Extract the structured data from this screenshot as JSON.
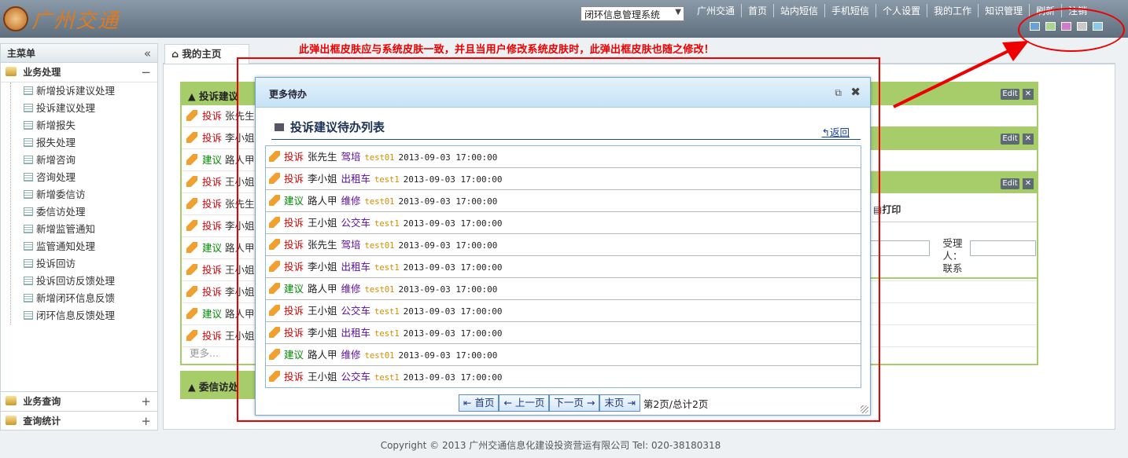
{
  "app": {
    "logo_text": "广州交通",
    "system_select": "闭环信息管理系统",
    "top_nav": [
      "广州交通",
      "首页",
      "站内短信",
      "手机短信",
      "个人设置",
      "我的工作",
      "知识管理",
      "刷新",
      "注销"
    ],
    "skin_colors": [
      "#6aa0d8",
      "#a8d690",
      "#d27ad0",
      "#c8c8c8",
      "#8cc8e8"
    ]
  },
  "sidebar": {
    "title": "主菜单",
    "collapse_glyph": "«",
    "group1": {
      "label": "业务处理",
      "toggle": "−",
      "items": [
        "新增投诉建议处理",
        "投诉建议处理",
        "新增报失",
        "报失处理",
        "新增咨询",
        "咨询处理",
        "新增委信访",
        "委信访处理",
        "新增监管通知",
        "监管通知处理",
        "投诉回访",
        "投诉回访反馈处理",
        "新增闭环信息反馈",
        "闭环信息反馈处理"
      ]
    },
    "group2": {
      "label": "业务查询",
      "toggle": "+"
    },
    "group3": {
      "label": "查询统计",
      "toggle": "+"
    }
  },
  "tabs": {
    "home": "我的主页"
  },
  "panels": {
    "panel1_title": "投诉建议",
    "panel4_title": "委信访处",
    "edit_label": "Edit",
    "close_label": "✕",
    "more_label": "更多...",
    "rows": [
      {
        "kind": "投诉",
        "name": "张先生",
        "color": "red"
      },
      {
        "kind": "投诉",
        "name": "李小姐",
        "color": "red"
      },
      {
        "kind": "建议",
        "name": "路人甲",
        "color": "green"
      },
      {
        "kind": "投诉",
        "name": "王小姐",
        "color": "red"
      },
      {
        "kind": "投诉",
        "name": "张先生",
        "color": "red"
      },
      {
        "kind": "投诉",
        "name": "李小姐",
        "color": "red"
      },
      {
        "kind": "建议",
        "name": "路人甲",
        "color": "green"
      },
      {
        "kind": "投诉",
        "name": "王小姐",
        "color": "red"
      },
      {
        "kind": "投诉",
        "name": "李小姐",
        "color": "red"
      },
      {
        "kind": "建议",
        "name": "路人甲",
        "color": "green"
      },
      {
        "kind": "投诉",
        "name": "王小姐",
        "color": "red"
      }
    ],
    "print_label": "打印",
    "field_label_1": "受理人：",
    "field_label_2": "联系"
  },
  "annotation": {
    "text": "此弹出框皮肤应与系统皮肤一致，并且当用户修改系统皮肤时，此弹出框皮肤也随之修改！"
  },
  "dialog": {
    "title": "更多待办",
    "popout_glyph": "⧉",
    "close_glyph": "✖",
    "list_title": "投诉建议待办列表",
    "back_label": "返回",
    "rows": [
      {
        "kind": "投诉",
        "name": "张先生",
        "category": "驾培",
        "user": "test01",
        "time": "2013-09-03 17:00:00",
        "color": "red"
      },
      {
        "kind": "投诉",
        "name": "李小姐",
        "category": "出租车",
        "user": "test1",
        "time": "2013-09-03 17:00:00",
        "color": "red"
      },
      {
        "kind": "建议",
        "name": "路人甲",
        "category": "维修",
        "user": "test01",
        "time": "2013-09-03 17:00:00",
        "color": "green"
      },
      {
        "kind": "投诉",
        "name": "王小姐",
        "category": "公交车",
        "user": "test1",
        "time": "2013-09-03 17:00:00",
        "color": "red"
      },
      {
        "kind": "投诉",
        "name": "张先生",
        "category": "驾培",
        "user": "test01",
        "time": "2013-09-03 17:00:00",
        "color": "red"
      },
      {
        "kind": "投诉",
        "name": "李小姐",
        "category": "出租车",
        "user": "test1",
        "time": "2013-09-03 17:00:00",
        "color": "red"
      },
      {
        "kind": "建议",
        "name": "路人甲",
        "category": "维修",
        "user": "test01",
        "time": "2013-09-03 17:00:00",
        "color": "green"
      },
      {
        "kind": "投诉",
        "name": "王小姐",
        "category": "公交车",
        "user": "test1",
        "time": "2013-09-03 17:00:00",
        "color": "red"
      },
      {
        "kind": "投诉",
        "name": "李小姐",
        "category": "出租车",
        "user": "test1",
        "time": "2013-09-03 17:00:00",
        "color": "red"
      },
      {
        "kind": "建议",
        "name": "路人甲",
        "category": "维修",
        "user": "test01",
        "time": "2013-09-03 17:00:00",
        "color": "green"
      },
      {
        "kind": "投诉",
        "name": "王小姐",
        "category": "公交车",
        "user": "test1",
        "time": "2013-09-03 17:00:00",
        "color": "red"
      }
    ],
    "pager": {
      "first": "⇤ 首页",
      "prev": "← 上一页",
      "next": "下一页 →",
      "last": "末页 ⇥",
      "info": "第2页/总计2页"
    }
  },
  "footer": "Copyright © 2013 广州交通信息化建设投资营运有限公司  Tel: 020-38180318"
}
